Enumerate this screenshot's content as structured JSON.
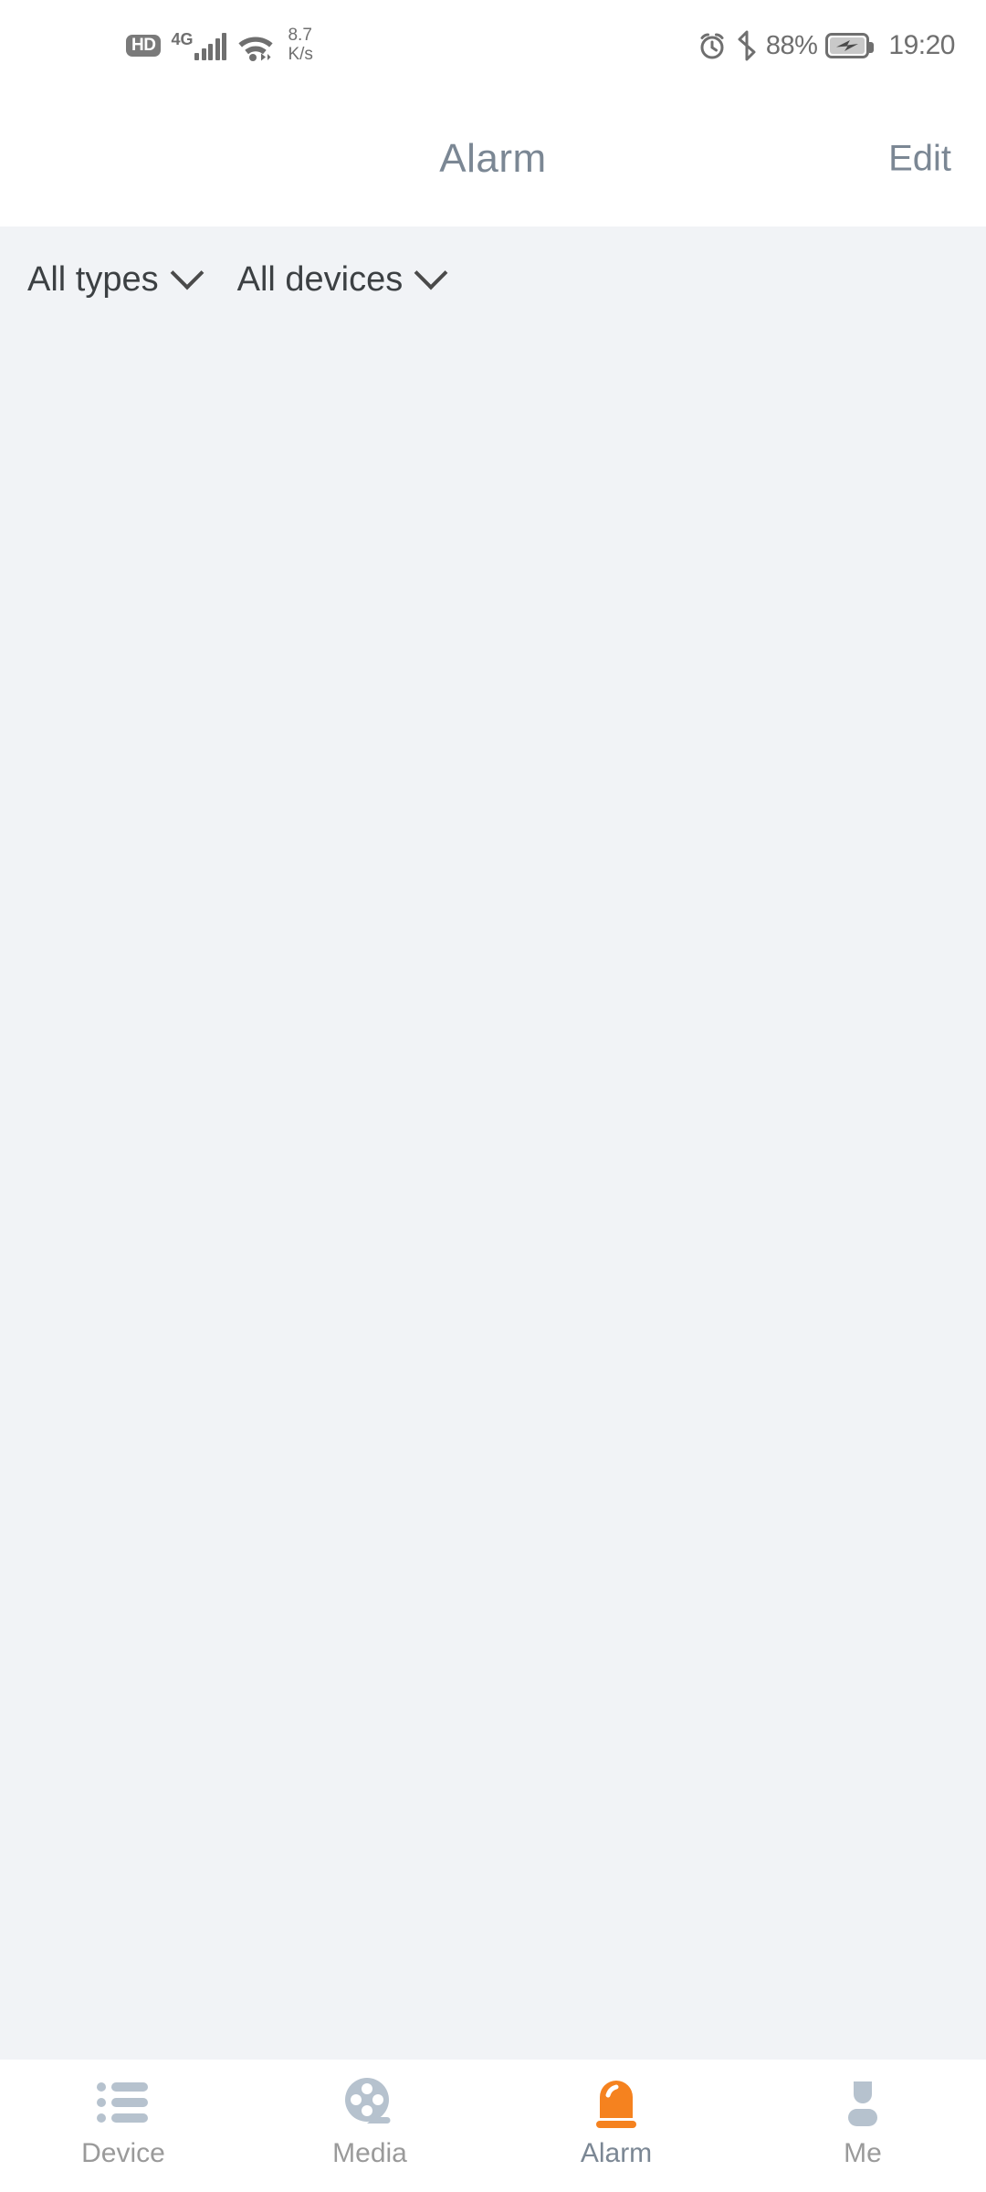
{
  "status_bar": {
    "hd_label": "HD",
    "network_generation": "4G",
    "net_speed_value": "8.7",
    "net_speed_unit": "K/s",
    "battery_percent": "88%",
    "time": "19:20",
    "icons": [
      "hd-badge",
      "cellular-signal-icon",
      "wifi-icon",
      "alarm-clock-icon",
      "bluetooth-icon",
      "battery-charging-icon"
    ]
  },
  "header": {
    "title": "Alarm",
    "edit_label": "Edit"
  },
  "filters": [
    {
      "label": "All types",
      "icon": "chevron-down-icon"
    },
    {
      "label": "All devices",
      "icon": "chevron-down-icon"
    }
  ],
  "alarm_list": {
    "items": [],
    "empty": true
  },
  "bottom_nav": {
    "active_index": 2,
    "tabs": [
      {
        "label": "Device",
        "icon": "list-icon"
      },
      {
        "label": "Media",
        "icon": "film-reel-icon"
      },
      {
        "label": "Alarm",
        "icon": "siren-icon"
      },
      {
        "label": "Me",
        "icon": "person-icon"
      }
    ]
  },
  "colors": {
    "accent": "#f5821f",
    "title": "#7b8794",
    "content_bg": "#f1f3f6",
    "inactive_icon": "#b6c2ce",
    "inactive_label": "#9a9a9a",
    "status_icon": "#6f6f6f"
  }
}
